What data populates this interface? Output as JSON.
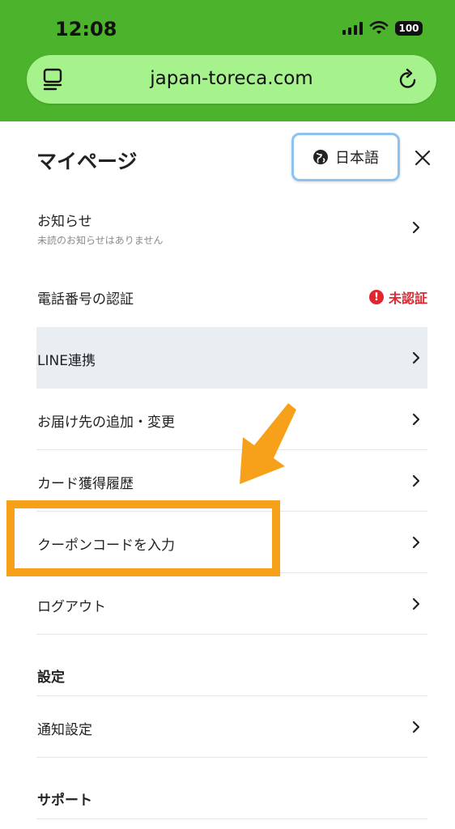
{
  "status_bar": {
    "time": "12:08",
    "battery": "100"
  },
  "browser": {
    "url": "japan-toreca.com"
  },
  "header": {
    "title": "マイページ",
    "language_button": "日本語"
  },
  "menu": {
    "notifications": {
      "label": "お知らせ",
      "subtext": "未読のお知らせはありません"
    },
    "phone_verification": {
      "label": "電話番号の認証",
      "status": "未認証"
    },
    "line": {
      "label": "LINE連携"
    },
    "address": {
      "label": "お届け先の追加・変更"
    },
    "card_history": {
      "label": "カード獲得履歴"
    },
    "coupon": {
      "label": "クーポンコードを入力"
    },
    "logout": {
      "label": "ログアウト"
    }
  },
  "settings": {
    "heading": "設定",
    "notification_settings": "通知設定"
  },
  "support": {
    "heading": "サポート"
  },
  "colors": {
    "browser_bar": "#4cb32c",
    "url_field": "#a6f28c",
    "warning": "#e2262f",
    "annotation": "#f7a11a",
    "highlight_row": "#e9eef3"
  }
}
